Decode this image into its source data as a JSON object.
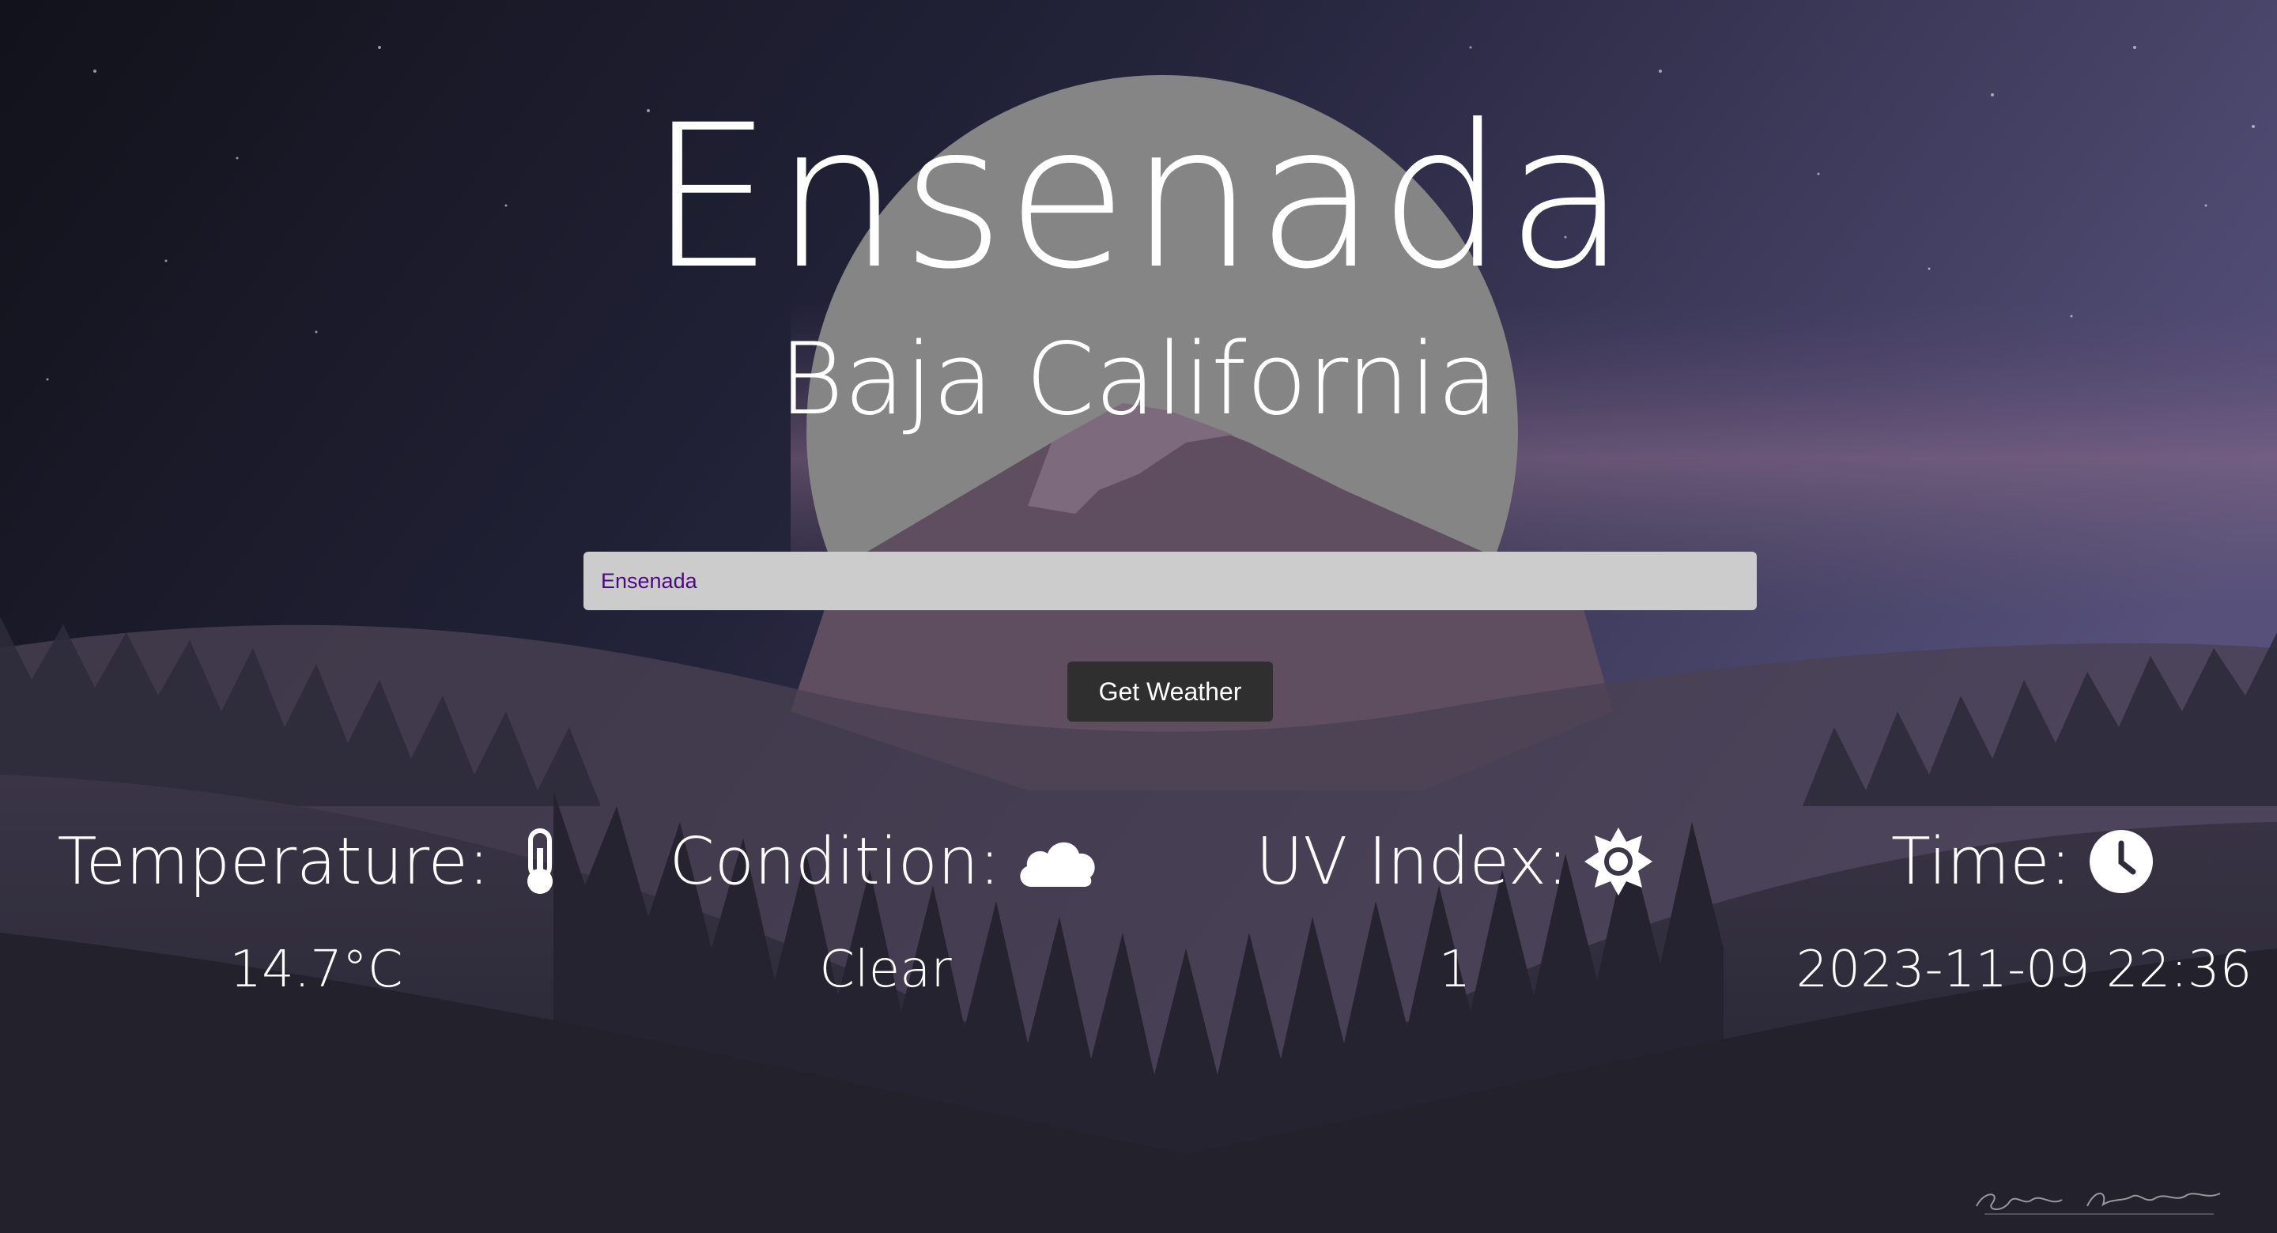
{
  "header": {
    "city": "Ensenada",
    "region": "Baja California"
  },
  "search": {
    "value": "Ensenada"
  },
  "actions": {
    "get_weather_label": "Get Weather"
  },
  "stats": {
    "temperature": {
      "label": "Temperature:",
      "value": "14.7°C",
      "icon": "thermometer-icon"
    },
    "condition": {
      "label": "Condition:",
      "value": "Clear",
      "icon": "cloud-icon"
    },
    "uv_index": {
      "label": "UV Index:",
      "value": "1",
      "icon": "sun-icon"
    },
    "time": {
      "label": "Time:",
      "value": "2023-11-09 22:36",
      "icon": "clock-icon"
    }
  },
  "colors": {
    "input_background": "#cccccc",
    "input_text": "#4b0a7d",
    "button_background": "#2f2f2f",
    "text": "#ffffff"
  }
}
